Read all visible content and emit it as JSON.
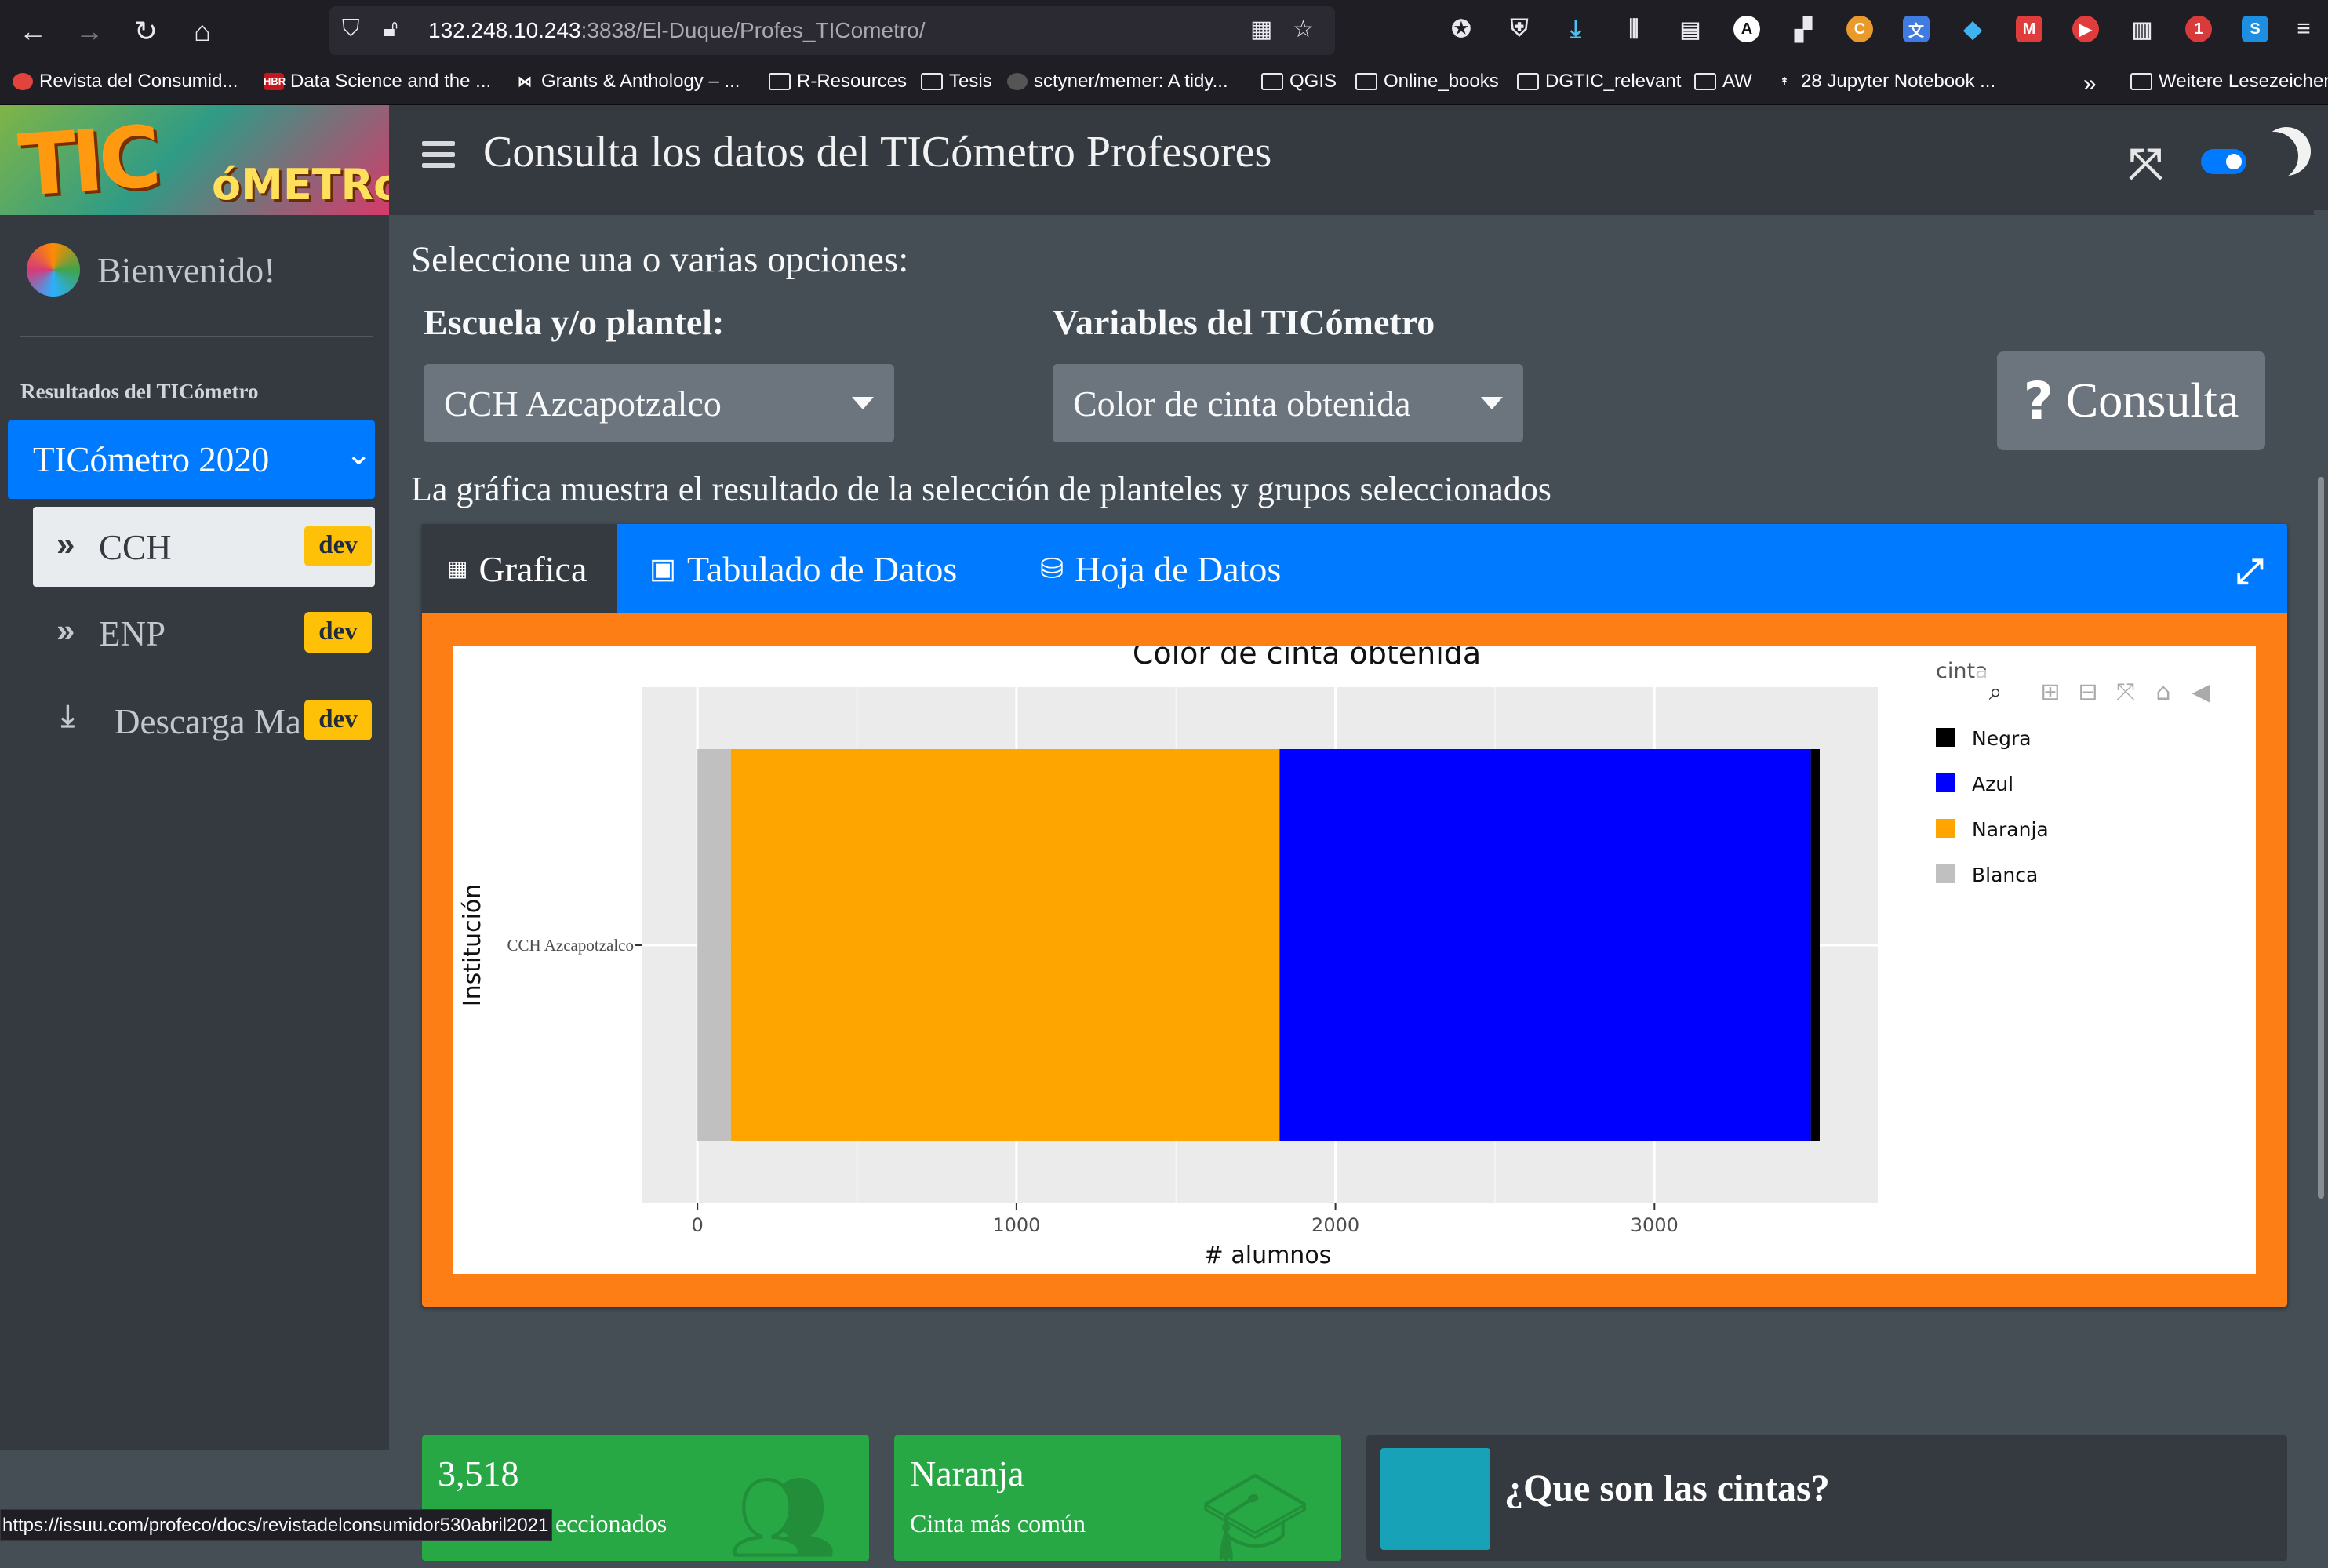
{
  "browser": {
    "url_host": "132.248.10.243",
    "url_path": ":3838/El-Duque/Profes_TICometro/",
    "bookmarks": [
      {
        "label": "Revista del Consumid...",
        "icon": "profeco-icon"
      },
      {
        "label": "Data Science and the ...",
        "icon": "hbr-icon"
      },
      {
        "label": "Grants & Anthology – ...",
        "icon": "bow-icon"
      },
      {
        "label": "R-Resources",
        "icon": "folder-icon"
      },
      {
        "label": "Tesis",
        "icon": "folder-icon"
      },
      {
        "label": "sctyner/memer: A tidy...",
        "icon": "github-icon"
      },
      {
        "label": "QGIS",
        "icon": "folder-icon"
      },
      {
        "label": "Online_books",
        "icon": "folder-icon"
      },
      {
        "label": "DGTIC_relevant",
        "icon": "folder-icon"
      },
      {
        "label": "AW",
        "icon": "folder-icon"
      },
      {
        "label": "28 Jupyter Notebook ...",
        "icon": "rocket-icon"
      },
      {
        "label": "Weitere Lesezeichen",
        "icon": "folder-icon"
      }
    ],
    "status_url": "https://issuu.com/profeco/docs/revistadelconsumidor530abril2021"
  },
  "sidebar": {
    "brand": "TICóMETRo",
    "user": "Bienvenido!",
    "section_header": "Resultados del TICómetro",
    "active_item": "TICómetro 2020",
    "items": [
      {
        "label": "CCH",
        "badge": "dev"
      },
      {
        "label": "ENP",
        "badge": "dev"
      },
      {
        "label": "Descarga Ma",
        "badge": "dev"
      }
    ]
  },
  "header": {
    "title": "Consulta los datos del TICómetro Profesores"
  },
  "main": {
    "prompt": "Seleccione una o varias opciones:",
    "school_label": "Escuela y/o plantel:",
    "school_value": "CCH Azcapotzalco",
    "variables_label": "Variables del TICómetro",
    "variables_value": "Color de cinta obtenida",
    "consulta_button": "Consulta",
    "subtitle": "La gráfica muestra el resultado de la selección de planteles y grupos seleccionados",
    "tabs": [
      {
        "label": "Grafica",
        "icon": "chart-icon"
      },
      {
        "label": "Tabulado de Datos",
        "icon": "calculator-icon"
      },
      {
        "label": "Hoja de Datos",
        "icon": "database-icon"
      }
    ],
    "colors": {
      "primary": "#007bff",
      "warning": "#fd7e14",
      "success": "#28a745",
      "info": "#17a2b8"
    }
  },
  "chart_data": {
    "type": "bar",
    "orientation": "horizontal",
    "stacked": true,
    "title": "Color de cinta obtenida",
    "xlabel": "# alumnos",
    "ylabel": "Institución",
    "categories": [
      "CCH Azcapotzalco"
    ],
    "legend_title": "cinta",
    "legend_position": "right",
    "xlim": [
      -175,
      3700
    ],
    "xticks": [
      0,
      1000,
      2000,
      3000
    ],
    "grid": true,
    "series": [
      {
        "name": "Blanca",
        "values": [
          105
        ],
        "color": "#c0c0c0"
      },
      {
        "name": "Naranja",
        "values": [
          1720
        ],
        "color": "#ffa500"
      },
      {
        "name": "Azul",
        "values": [
          1665
        ],
        "color": "#0000ff"
      },
      {
        "name": "Negra",
        "values": [
          28
        ],
        "color": "#000000"
      }
    ],
    "legend_order": [
      "Negra",
      "Azul",
      "Naranja",
      "Blanca"
    ]
  },
  "value_boxes": [
    {
      "number": "3,518",
      "text": "eccionados",
      "color": "#28a745",
      "icon": "users-icon"
    },
    {
      "number": "Naranja",
      "text": "Cinta más común",
      "color": "#28a745",
      "icon": "graduation-cap-icon"
    },
    {
      "number": "",
      "text": "¿Que son las cintas?",
      "color": "#343a40",
      "icon": ""
    }
  ]
}
